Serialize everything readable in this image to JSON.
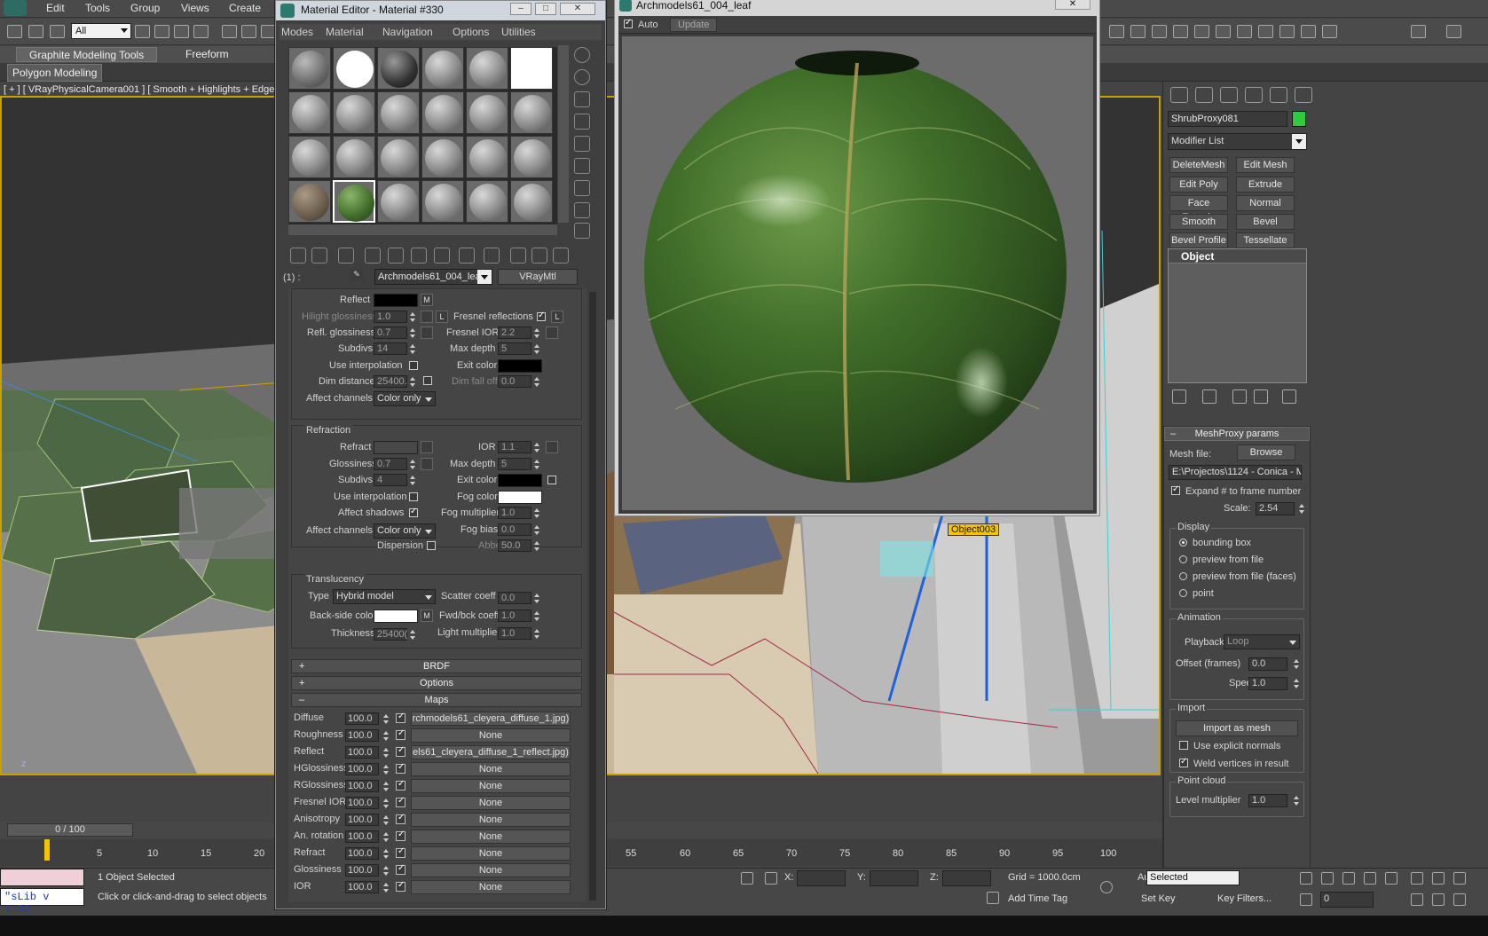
{
  "menu": {
    "items": [
      "Edit",
      "Tools",
      "Group",
      "Views",
      "Create"
    ]
  },
  "toolbar": {
    "selection_filter": "All"
  },
  "ribbon": {
    "tabs": [
      "Graphite Modeling Tools",
      "Freeform"
    ],
    "subtab": "Polygon Modeling"
  },
  "viewport": {
    "label": "[ + ] [ VRayPhysicalCamera001 ] [ Smooth + Highlights + Edged F",
    "object_tag": "Object003",
    "axis": "z"
  },
  "material_editor": {
    "title": "Material Editor - Material #330",
    "menus": [
      "Modes",
      "Material",
      "Navigation",
      "Options",
      "Utilities"
    ],
    "slot_index": "(1) :",
    "material_name": "Archmodels61_004_leaf",
    "material_type": "VRayMtl",
    "reflection": {
      "reflect_label": "Reflect",
      "m_label": "M",
      "hilight_glossiness_label": "Hilight glossiness",
      "hilight_glossiness": "1.0",
      "l_label": "L",
      "fresnel_label": "Fresnel reflections",
      "refl_glossiness_label": "Refl. glossiness",
      "refl_glossiness": "0.7",
      "fresnel_ior_label": "Fresnel IOR",
      "fresnel_ior": "2.2",
      "subdivs_label": "Subdivs",
      "subdivs": "14",
      "max_depth_label": "Max depth",
      "max_depth": "5",
      "use_interp_label": "Use interpolation",
      "exit_color_label": "Exit color",
      "dim_distance_label": "Dim distance",
      "dim_distance": "25400.",
      "dim_falloff_label": "Dim fall off",
      "dim_falloff": "0.0",
      "affect_channels_label": "Affect channels",
      "affect_channels": "Color only"
    },
    "refraction": {
      "title": "Refraction",
      "refract_label": "Refract",
      "ior_label": "IOR",
      "ior": "1.1",
      "glossiness_label": "Glossiness",
      "glossiness": "0.7",
      "max_depth_label": "Max depth",
      "max_depth": "5",
      "subdivs_label": "Subdivs",
      "subdivs": "4",
      "exit_color_label": "Exit color",
      "use_interp_label": "Use interpolation",
      "fog_color_label": "Fog color",
      "affect_shadows_label": "Affect shadows",
      "fog_multiplier_label": "Fog multiplier",
      "fog_multiplier": "1.0",
      "affect_channels_label": "Affect channels",
      "affect_channels": "Color only",
      "fog_bias_label": "Fog bias",
      "fog_bias": "0.0",
      "dispersion_label": "Dispersion",
      "abbe_label": "Abbe",
      "abbe": "50.0"
    },
    "translucency": {
      "title": "Translucency",
      "type_label": "Type",
      "type": "Hybrid model",
      "scatter_label": "Scatter coeff",
      "scatter": "0.0",
      "backside_label": "Back-side color",
      "m_label": "M",
      "fwd_label": "Fwd/bck coeff",
      "fwd": "1.0",
      "thickness_label": "Thickness",
      "thickness": "25400(",
      "light_mult_label": "Light multiplier",
      "light_mult": "1.0"
    },
    "rollouts": [
      "BRDF",
      "Options",
      "Maps"
    ],
    "maps": [
      {
        "label": "Diffuse",
        "value": "100.0",
        "map": "rchmodels61_cleyera_diffuse_1.jpg)"
      },
      {
        "label": "Roughness",
        "value": "100.0",
        "map": "None"
      },
      {
        "label": "Reflect",
        "value": "100.0",
        "map": "els61_cleyera_diffuse_1_reflect.jpg)"
      },
      {
        "label": "HGlossiness",
        "value": "100.0",
        "map": "None"
      },
      {
        "label": "RGlossiness",
        "value": "100.0",
        "map": "None"
      },
      {
        "label": "Fresnel IOR",
        "value": "100.0",
        "map": "None"
      },
      {
        "label": "Anisotropy",
        "value": "100.0",
        "map": "None"
      },
      {
        "label": "An. rotation",
        "value": "100.0",
        "map": "None"
      },
      {
        "label": "Refract",
        "value": "100.0",
        "map": "None"
      },
      {
        "label": "Glossiness",
        "value": "100.0",
        "map": "None"
      },
      {
        "label": "IOR",
        "value": "100.0",
        "map": "None"
      }
    ]
  },
  "preview": {
    "title": "Archmodels61_004_leaf",
    "auto_label": "Auto",
    "update_label": "Update"
  },
  "command_panel": {
    "object_name": "ShrubProxy081",
    "object_color": "#2ecc40",
    "modifier_list": "Modifier List",
    "modifier_buttons": [
      "DeleteMesh",
      "Edit Mesh",
      "Edit Poly",
      "Extrude",
      "Face Extrude",
      "Normal",
      "Smooth",
      "Bevel",
      "Bevel Profile",
      "Tessellate"
    ],
    "stack_item": "Object",
    "meshproxy": {
      "title": "MeshProxy params",
      "mesh_file_label": "Mesh file:",
      "browse": "Browse",
      "path": "E:\\Projectos\\1124 - Conica - Mu",
      "expand_label": "Expand # to frame number",
      "scale_label": "Scale:",
      "scale": "2.54",
      "display_title": "Display",
      "display_options": [
        "bounding box",
        "preview from file",
        "preview from file (faces)",
        "point"
      ],
      "animation_title": "Animation",
      "playback_label": "Playback",
      "playback": "Loop",
      "offset_label": "Offset (frames)",
      "offset": "0.0",
      "speed_label": "Speed",
      "speed": "1.0",
      "import_title": "Import",
      "import_btn": "Import as mesh",
      "explicit_normals": "Use explicit normals",
      "weld_label": "Weld vertices in result",
      "pointcloud_title": "Point cloud",
      "level_label": "Level multiplier",
      "level": "1.0"
    }
  },
  "timeline": {
    "slider": "0 / 100",
    "ticks": [
      "0",
      "5",
      "10",
      "15",
      "20",
      "55",
      "60",
      "65",
      "70",
      "75",
      "80",
      "85",
      "90",
      "95",
      "100"
    ]
  },
  "status": {
    "maxscript": "\"sLib v 1.32",
    "selected": "1 Object Selected",
    "prompt": "Click or click-and-drag to select objects",
    "x_label": "X:",
    "y_label": "Y:",
    "z_label": "Z:",
    "grid": "Grid = 1000.0cm",
    "add_time_tag": "Add Time Tag",
    "auto_key": "Auto Key",
    "set_key": "Set Key",
    "selected_dropdown": "Selected",
    "key_filters": "Key Filters...",
    "frame": "0"
  }
}
